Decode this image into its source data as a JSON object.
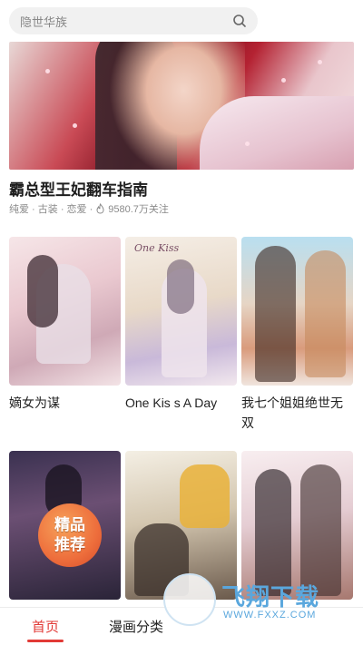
{
  "search": {
    "placeholder": "隐世华族",
    "icon": "search-icon"
  },
  "featured": {
    "title": "霸总型王妃翻车指南",
    "tags": "纯爱 · 古装 · 恋爱 ·",
    "popularity": "9580.7万关注",
    "popularity_icon": "flame-icon"
  },
  "cards": [
    {
      "title": "嫡女为谋"
    },
    {
      "title": "One Kis s A Day",
      "cover_logo": "One Kiss"
    },
    {
      "title": "我七个姐姐绝世无双"
    },
    {
      "title": "",
      "badge_line1": "精品",
      "badge_line2": "推荐"
    },
    {
      "title": ""
    },
    {
      "title": ""
    }
  ],
  "bottom_nav": {
    "tabs": [
      {
        "label": "首页",
        "active": true
      },
      {
        "label": "漫画分类"
      },
      {
        "label": ""
      },
      {
        "label": ""
      }
    ]
  },
  "watermark": {
    "text": "飞翔下载",
    "url": "WWW.FXXZ.COM"
  },
  "colors": {
    "accent": "#e23a36",
    "watermark": "#5aa7dd"
  }
}
